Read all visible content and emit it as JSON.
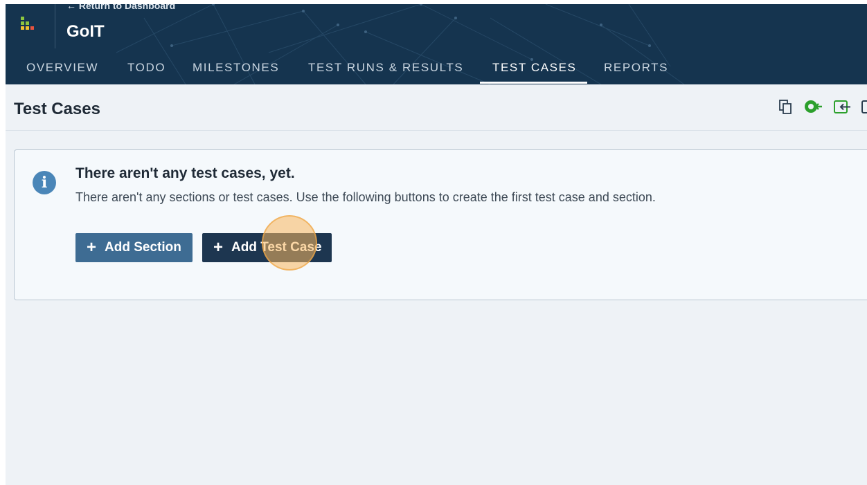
{
  "header": {
    "return_link": "← Return to Dashboard",
    "project_name": "GoIT",
    "background": "#15344f"
  },
  "tabs": [
    {
      "label": "OVERVIEW",
      "active": false
    },
    {
      "label": "TODO",
      "active": false
    },
    {
      "label": "MILESTONES",
      "active": false
    },
    {
      "label": "TEST RUNS & RESULTS",
      "active": false
    },
    {
      "label": "TEST CASES",
      "active": true
    },
    {
      "label": "REPORTS",
      "active": false
    }
  ],
  "page": {
    "title": "Test Cases"
  },
  "toolbar": {
    "icons": [
      "copy-icon",
      "import-green-icon",
      "import-icon",
      "export-icon"
    ],
    "accent_green": "#2ca02c"
  },
  "info_panel": {
    "icon": "info-icon",
    "heading": "There aren't any test cases, yet.",
    "message": "There aren't any sections or test cases. Use the following buttons to create the first test case and section.",
    "add_section_label": "Add Section",
    "add_test_case_label": "Add Test Case"
  }
}
